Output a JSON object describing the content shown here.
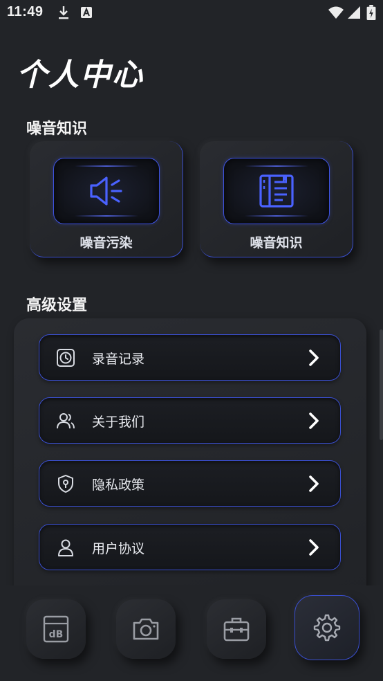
{
  "status_bar": {
    "time": "11:49",
    "icons": [
      "download-icon",
      "a-icon",
      "wifi-icon",
      "signal-icon",
      "battery-icon"
    ]
  },
  "page_title": "个人中心",
  "knowledge": {
    "section_title": "噪音知识",
    "cards": [
      {
        "label": "噪音污染",
        "icon": "speaker-icon"
      },
      {
        "label": "噪音知识",
        "icon": "book-icon"
      }
    ]
  },
  "advanced": {
    "section_title": "高级设置",
    "items": [
      {
        "label": "录音记录",
        "icon": "clock-icon"
      },
      {
        "label": "关于我们",
        "icon": "users-icon"
      },
      {
        "label": "隐私政策",
        "icon": "shield-icon"
      },
      {
        "label": "用户协议",
        "icon": "user-icon"
      }
    ]
  },
  "bottom_nav": {
    "items": [
      {
        "icon": "db-meter-icon",
        "text": "dB",
        "active": false
      },
      {
        "icon": "camera-icon",
        "active": false
      },
      {
        "icon": "toolbox-icon",
        "active": false
      },
      {
        "icon": "gear-icon",
        "active": true
      }
    ]
  },
  "colors": {
    "background": "#222428",
    "accent": "#3a4fd0",
    "icon_blue": "#4a62ff",
    "text": "#e8eaef"
  }
}
